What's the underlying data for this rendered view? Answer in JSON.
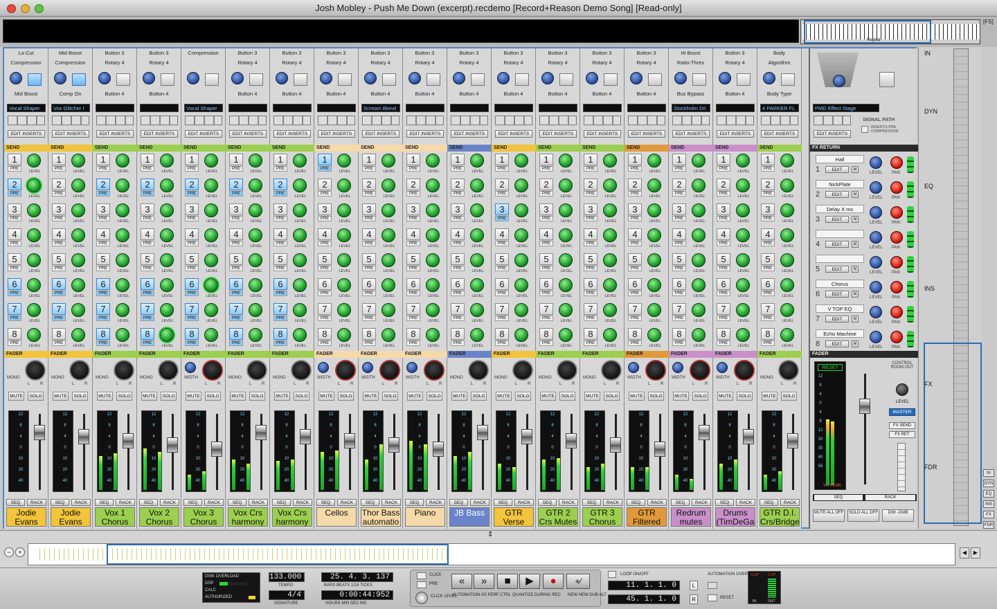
{
  "window": {
    "title": "Josh Mobley - Push Me Down (excerpt).recdemo [Record+Reason Demo Song] [Read-only]",
    "fs": "[FS]",
    "repeat": "Repeat"
  },
  "colors": {
    "accent": "#2b6bb5",
    "green": "#1e9a2a",
    "yellow": "#f4c544",
    "cyan": "#86c7ff"
  },
  "channels": [
    {
      "h1": "Lo Cut",
      "h2": "Compression",
      "btn": "Mid Boost",
      "insert": "Vocal Shaper",
      "name": "Jodie Evans",
      "color": "#f2c43c",
      "sendcolor": "#f2c43c",
      "pan": "mono",
      "lit": [
        2,
        6,
        7
      ],
      "send_lit": [
        2
      ],
      "meter": [
        0,
        0
      ]
    },
    {
      "h1": "Mid Boost",
      "h2": "Compression",
      "btn": "Comp On",
      "insert": "Vox Glitcher I",
      "name": "Jodie Evans",
      "color": "#f2c43c",
      "sendcolor": "#f2c43c",
      "pan": "mono",
      "lit": [
        6,
        7
      ],
      "send_lit": [],
      "meter": [
        0,
        0
      ]
    },
    {
      "h1": "Button 3",
      "h2": "Rotary 4",
      "btn": "Button 4",
      "insert": "",
      "name": "Vox 1 Chorus",
      "color": "#9ccf4f",
      "sendcolor": "#9ccf4f",
      "pan": "mono",
      "lit": [
        2,
        6,
        7,
        8
      ],
      "send_lit": [],
      "meter": [
        0.45,
        0.48
      ]
    },
    {
      "h1": "Button 3",
      "h2": "Rotary 4",
      "btn": "Button 4",
      "insert": "",
      "name": "Vox 2 Chorus",
      "color": "#9ccf4f",
      "sendcolor": "#9ccf4f",
      "pan": "mono",
      "lit": [
        2,
        6,
        7,
        8
      ],
      "send_lit": [
        8
      ],
      "meter": [
        0.55,
        0.5
      ]
    },
    {
      "h1": "Compression",
      "h2": "",
      "btn": "",
      "insert": "Vocal Shaper",
      "name": "Vox 3 Chorus",
      "color": "#9ccf4f",
      "sendcolor": "#9ccf4f",
      "pan": "width",
      "lit": [
        2,
        6,
        7,
        8
      ],
      "send_lit": [
        6
      ],
      "meter": [
        0.2,
        0.25
      ]
    },
    {
      "h1": "Button 3",
      "h2": "Rotary 4",
      "btn": "Button 4",
      "insert": "",
      "name": "Vox Crs harmony 1",
      "color": "#9ccf4f",
      "sendcolor": "#9ccf4f",
      "pan": "mono",
      "lit": [
        2,
        6,
        7,
        8
      ],
      "send_lit": [],
      "meter": [
        0.4,
        0.35
      ]
    },
    {
      "h1": "Button 3",
      "h2": "Rotary 4",
      "btn": "Button 4",
      "insert": "",
      "name": "Vox Crs harmony 2",
      "color": "#9ccf4f",
      "sendcolor": "#9ccf4f",
      "pan": "mono",
      "lit": [
        2,
        6,
        7,
        8
      ],
      "send_lit": [],
      "meter": [
        0.38,
        0.4
      ]
    },
    {
      "h1": "Button 3",
      "h2": "Rotary 4",
      "btn": "Button 4",
      "insert": "",
      "name": "Cellos",
      "color": "#f5d9a8",
      "sendcolor": "#f5d9a8",
      "pan": "width",
      "lit": [
        1
      ],
      "send_lit": [],
      "meter": [
        0.5,
        0.52
      ]
    },
    {
      "h1": "Button 3",
      "h2": "Rotary 4",
      "btn": "Button 4",
      "insert": "Scream Blend",
      "name": "Thor Bass automatio",
      "color": "#f5d9a8",
      "sendcolor": "#f5d9a8",
      "pan": "width",
      "lit": [],
      "send_lit": [],
      "meter": [
        0.4,
        0.6
      ]
    },
    {
      "h1": "Button 3",
      "h2": "Rotary 4",
      "btn": "Button 4",
      "insert": "",
      "name": "Piano",
      "color": "#f5d9a8",
      "sendcolor": "#f5d9a8",
      "pan": "width",
      "lit": [],
      "send_lit": [],
      "meter": [
        0.65,
        0.6
      ]
    },
    {
      "h1": "Button 3",
      "h2": "Rotary 4",
      "btn": "Button 4",
      "insert": "",
      "name": "JB Bass",
      "color": "#6a84c9",
      "sendcolor": "#6a84c9",
      "pan": "mono",
      "lit": [],
      "send_lit": [],
      "meter": [
        0.45,
        0.5
      ]
    },
    {
      "h1": "Button 3",
      "h2": "Rotary 4",
      "btn": "Button 4",
      "insert": "",
      "name": "GTR Verse",
      "color": "#f2c43c",
      "sendcolor": "#f2c43c",
      "pan": "mono",
      "lit": [
        3
      ],
      "send_lit": [],
      "meter": [
        0.35,
        0.3
      ]
    },
    {
      "h1": "Button 3",
      "h2": "Rotary 4",
      "btn": "Button 4",
      "insert": "",
      "name": "GTR 2 Crs Mutes",
      "color": "#9ccf4f",
      "sendcolor": "#9ccf4f",
      "pan": "mono",
      "lit": [],
      "send_lit": [],
      "meter": [
        0.4,
        0.42
      ]
    },
    {
      "h1": "Button 3",
      "h2": "Rotary 4",
      "btn": "Button 4",
      "insert": "",
      "name": "GTR 3 Chorus",
      "color": "#9ccf4f",
      "sendcolor": "#9ccf4f",
      "pan": "mono",
      "lit": [],
      "send_lit": [],
      "meter": [
        0.3,
        0.35
      ]
    },
    {
      "h1": "Button 3",
      "h2": "Rotary 4",
      "btn": "Button 4",
      "insert": "",
      "name": "GTR Filtered",
      "color": "#e09a3a",
      "sendcolor": "#e09a3a",
      "pan": "width",
      "lit": [],
      "send_lit": [],
      "meter": [
        0.3,
        0.3
      ]
    },
    {
      "h1": "Hi Boost",
      "h2": "Ratio-Thres",
      "btn": "Bus Bypass",
      "insert": "Stockholm Dri",
      "name": "Redrum mutes",
      "color": "#c98fc9",
      "sendcolor": "#c98fc9",
      "pan": "width",
      "lit": [],
      "send_lit": [],
      "meter": [
        0.2,
        0.15
      ]
    },
    {
      "h1": "Button 3",
      "h2": "Rotary 4",
      "btn": "Button 4",
      "insert": "",
      "name": "Drums (TimDeGa",
      "color": "#c98fc9",
      "sendcolor": "#c98fc9",
      "pan": "width",
      "lit": [],
      "send_lit": [],
      "meter": [
        0.35,
        0.4
      ]
    },
    {
      "h1": "Body",
      "h2": "Algorithm",
      "btn": "Body Type",
      "insert": "4 PARKER FL",
      "name": "GTR D.I. Crs/Bridge",
      "color": "#9ccf4f",
      "sendcolor": "#9ccf4f",
      "pan": "mono",
      "lit": [],
      "send_lit": [],
      "meter": [
        0.2,
        0.25
      ]
    }
  ],
  "labels": {
    "send": "SEND",
    "fader": "FADER",
    "pre": "PRE",
    "level": "LEVEL",
    "edit_inserts": "EDIT INSERTS",
    "mute": "MUTE",
    "solo": "SOLO",
    "width": "WIDTH",
    "mono": "MONO",
    "l": "L",
    "r": "R",
    "seq": "SEQ",
    "rack": "RACK",
    "send_numbers": [
      "1",
      "2",
      "3",
      "4",
      "5",
      "6",
      "7",
      "8"
    ],
    "meter_scale": [
      "12",
      "8",
      "4",
      "0",
      "10",
      "20",
      "40"
    ]
  },
  "fx_return": {
    "title": "FX RETURN",
    "insert_title": "PMD Effect Stage",
    "signal_path": "SIGNAL PATH",
    "inserts_pre": "INSERTS PRE",
    "compressor": "COMPRESSOR",
    "edit": "EDIT",
    "m": "M",
    "level": "LEVEL",
    "pan": "PAN",
    "rows": [
      {
        "n": "1",
        "name": "Hall"
      },
      {
        "n": "2",
        "name": "NickPlate"
      },
      {
        "n": "3",
        "name": "Delay X ms"
      },
      {
        "n": "4",
        "name": ""
      },
      {
        "n": "5",
        "name": ""
      },
      {
        "n": "6",
        "name": "Chorus"
      },
      {
        "n": "7",
        "name": "V TOP EQ"
      },
      {
        "n": "8",
        "name": "Echo Machine"
      }
    ],
    "fader": "FADER",
    "reset": "RESET",
    "vu": "VU",
    "peak": "PEAK",
    "control_room": "CONTROL ROOM OUT",
    "master": "MASTER",
    "fx_send": "FX SEND",
    "fx_ret": "FX RET",
    "seq": "SEQ",
    "rack": "RACK",
    "mute_all": "MUTE ALL OFF",
    "solo_all": "SOLO ALL OFF",
    "dim": "DIM -20dB",
    "master_scale": [
      "12",
      "8",
      "4",
      "0",
      "4",
      "8",
      "12",
      "20",
      "30",
      "40",
      "56"
    ]
  },
  "right_panel": {
    "sections": [
      "IN",
      "DYN",
      "EQ",
      "INS",
      "FX",
      "FDR"
    ],
    "mini_icons": [
      "IN",
      "DYN",
      "EQ",
      "INS",
      "FX",
      "FDR"
    ]
  },
  "transport": {
    "disk_overload": "DISK OVERLOAD",
    "dsp": "DSP",
    "calc": "CALC",
    "authorized": "AUTHORIZED",
    "tempo_value": "133.000",
    "tempo_label": "TEMPO",
    "signature_value": "4/4",
    "signature_label": "SIGNATURE",
    "position": "25. 4. 3. 137",
    "position_labels": "BARS BEATS 1/16 TICKS",
    "time": "0:00:44:952",
    "time_labels": "HOURS MIN SEC MS",
    "click": "CLICK",
    "pre": "PRE",
    "click_level": "CLICK LEVEL",
    "automation": "AUTOMATION AS PERF CTRL",
    "quantize": "QUANTIZE DURING REC",
    "new_dub": "NEW NEW DUB ALT",
    "loop_onoff": "LOOP ON/OFF",
    "left_loc": "11. 1. 1. 0",
    "right_loc": "45. 1. 1. 0",
    "l": "L",
    "r": "R",
    "auto_override": "AUTOMATION OVERRIDE",
    "reset": "RESET",
    "clip": "CLIP",
    "in": "IN",
    "out": "OUT"
  }
}
